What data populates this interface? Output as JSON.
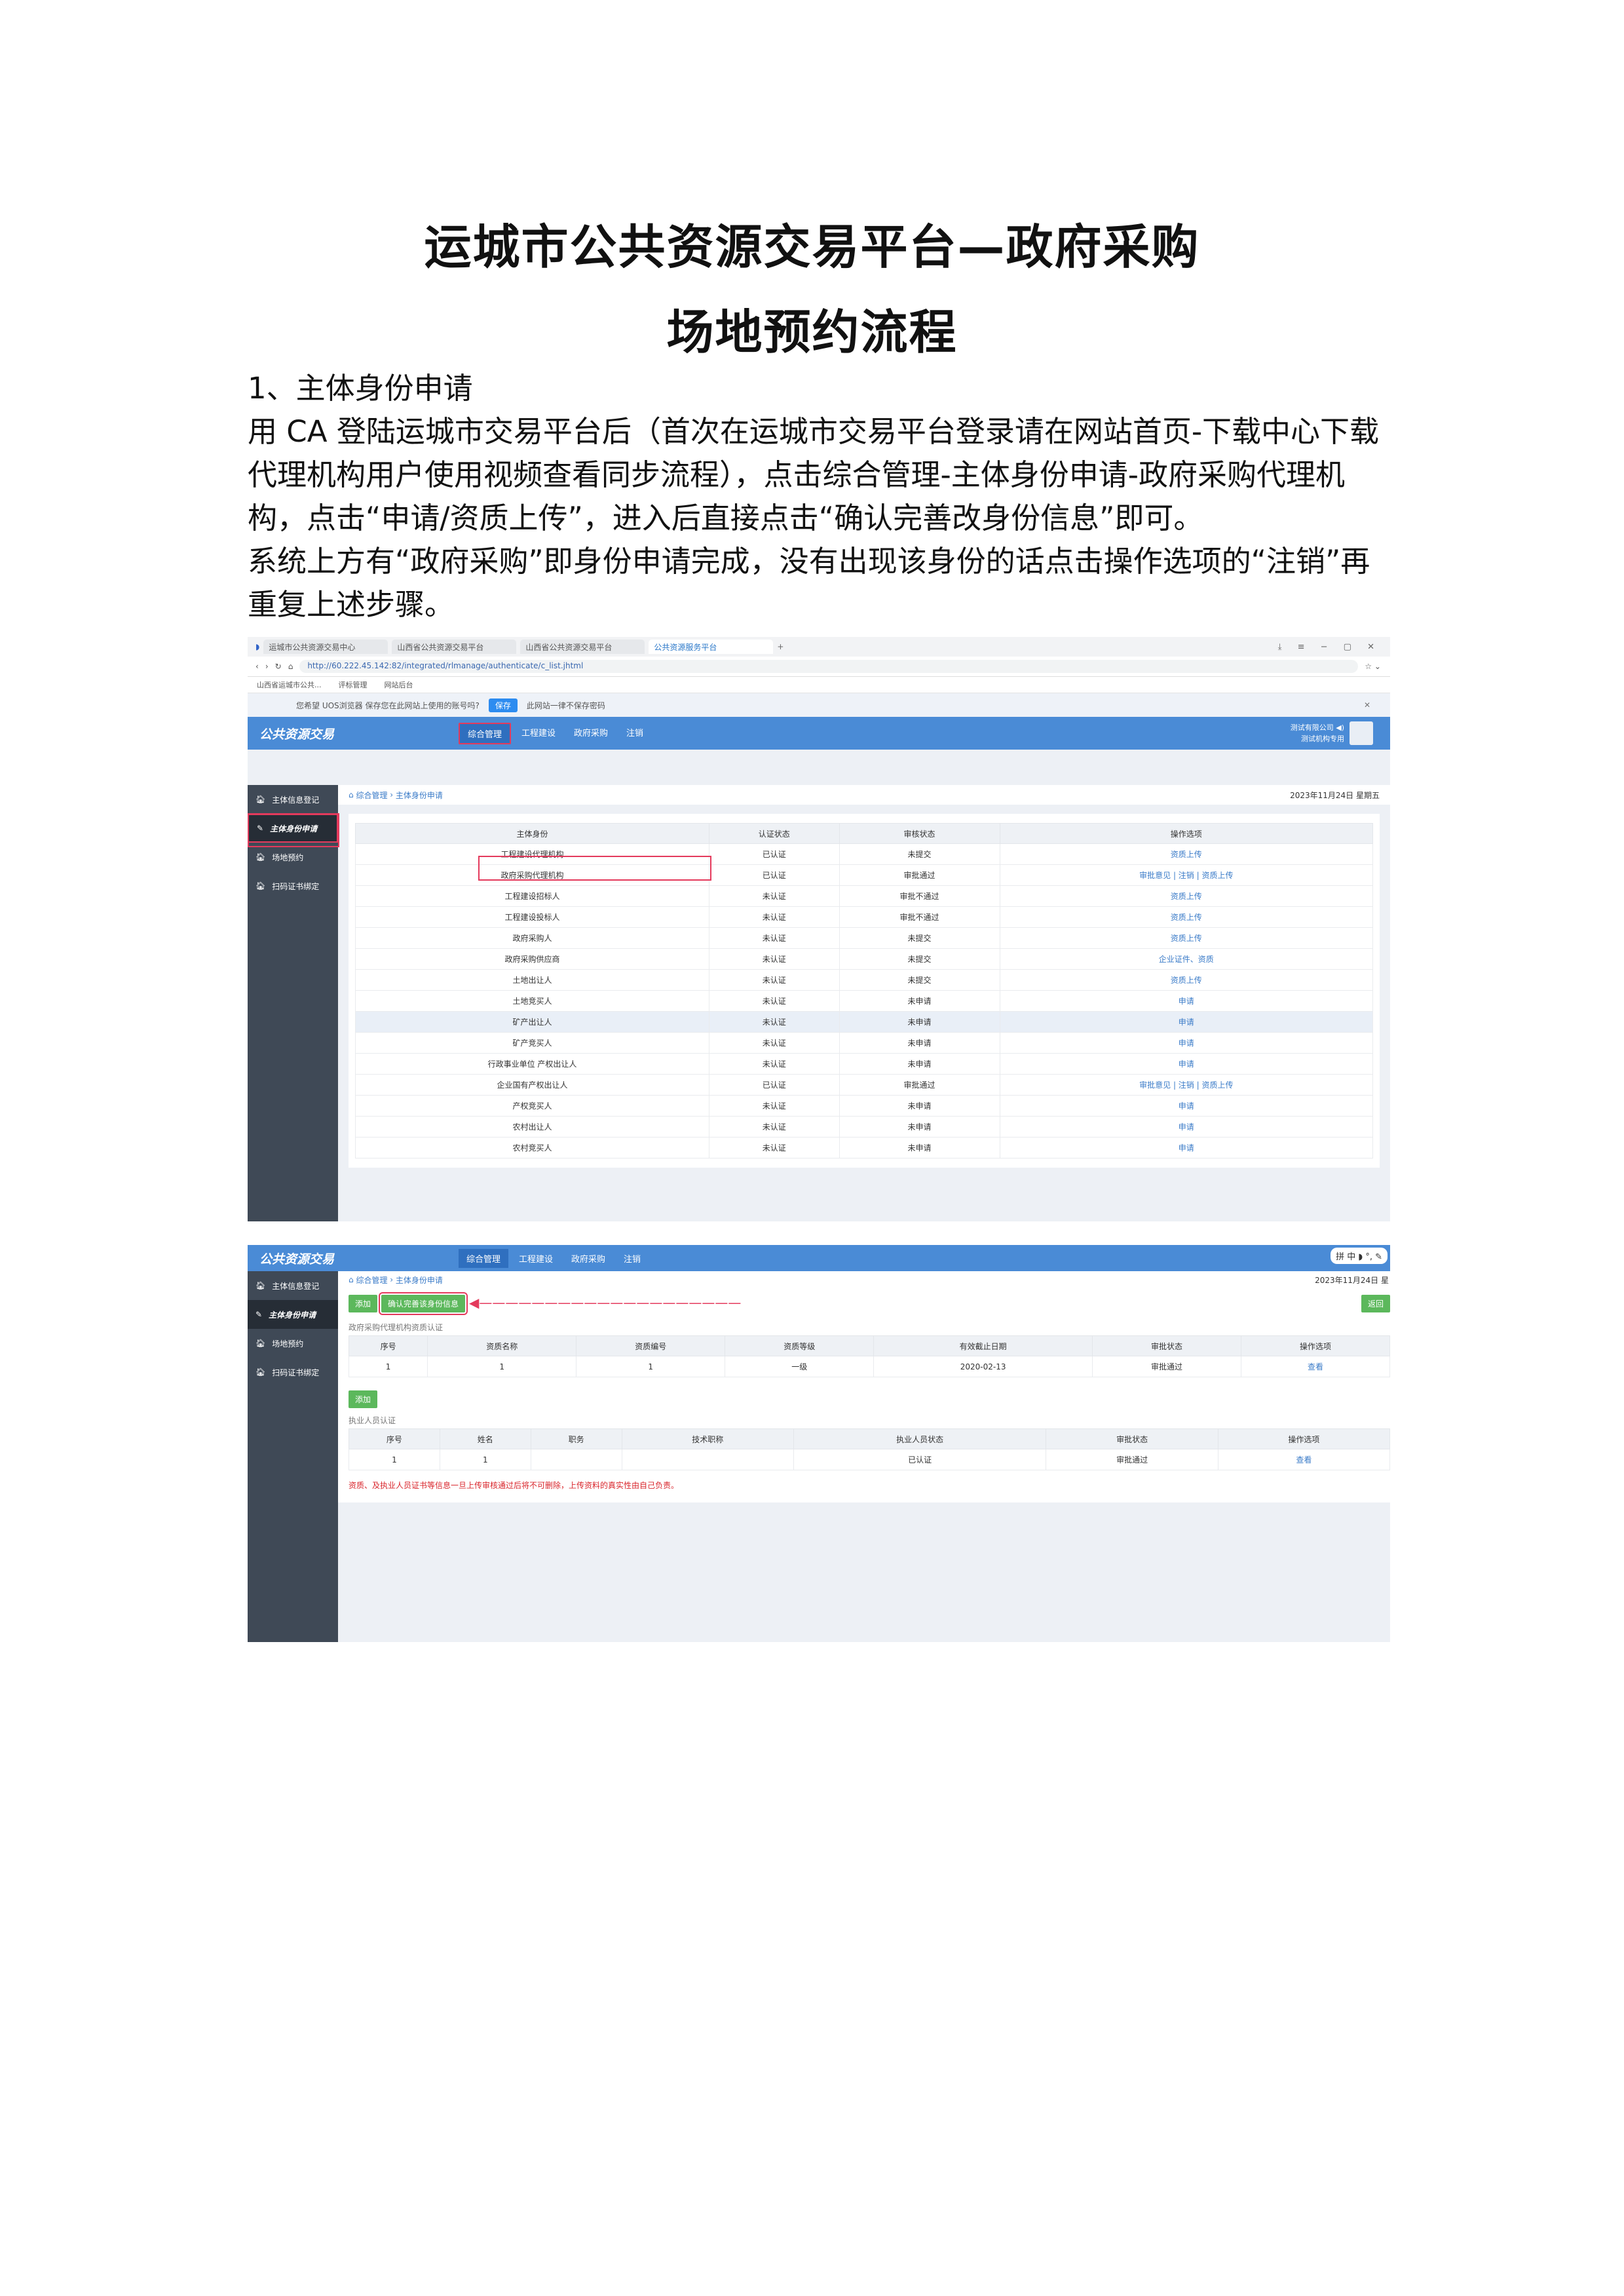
{
  "doc": {
    "title_line1": "运城市公共资源交易平台—政府采购",
    "title_line2": "场地预约流程",
    "section_heading": "1、主体身份申请",
    "body": "用 CA 登陆运城市交易平台后（首次在运城市交易平台登录请在网站首页-下载中心下载代理机构用户使用视频查看同步流程），点击综合管理-主体身份申请-政府采购代理机构，点击“申请/资质上传”，进入后直接点击“确认完善改身份信息”即可。",
    "note": "系统上方有“政府采购”即身份申请完成，没有出现该身份的话点击操作选项的“注销”再重复上述步骤。"
  },
  "browser": {
    "tabs": [
      "运城市公共资源交易中心",
      "山西省公共资源交易平台",
      "山西省公共资源交易平台",
      "公共资源服务平台"
    ],
    "url": "http://60.222.45.142:82/integrated/rlmanage/authenticate/c_list.jhtml",
    "bookmarks": [
      "山西省运城市公共...",
      "评标管理",
      "网站后台"
    ],
    "notice_text": "您希望 UOS浏览器 保存您在此网站上使用的账号吗?",
    "notice_save": "保存",
    "notice_never": "此网站一律不保存密码"
  },
  "app": {
    "logo": "公共资源交易",
    "nav": [
      "综合管理",
      "工程建设",
      "政府采购",
      "注销"
    ],
    "user_line1": "测试有限公司 ◀)",
    "user_line2": "测试机构专用",
    "sidebar": [
      "主体信息登记",
      "主体身份申请",
      "场地预约",
      "扫码证书绑定"
    ],
    "crumb": [
      "综合管理",
      "主体身份申请"
    ],
    "date1": "2023年11月24日 星期五",
    "date2": "2023年11月24日 星"
  },
  "table1": {
    "headers": [
      "主体身份",
      "认证状态",
      "审核状态",
      "操作选项"
    ],
    "rows": [
      [
        "工程建设代理机构",
        "已认证",
        "未提交",
        "资质上传"
      ],
      [
        "政府采购代理机构",
        "已认证",
        "审批通过",
        "审批意见 | 注销 | 资质上传"
      ],
      [
        "工程建设招标人",
        "未认证",
        "审批不通过",
        "资质上传"
      ],
      [
        "工程建设投标人",
        "未认证",
        "审批不通过",
        "资质上传"
      ],
      [
        "政府采购人",
        "未认证",
        "未提交",
        "资质上传"
      ],
      [
        "政府采购供应商",
        "未认证",
        "未提交",
        "企业证件、资质"
      ],
      [
        "土地出让人",
        "未认证",
        "未提交",
        "资质上传"
      ],
      [
        "土地竞买人",
        "未认证",
        "未申请",
        "申请"
      ],
      [
        "矿产出让人",
        "未认证",
        "未申请",
        "申请"
      ],
      [
        "矿产竞买人",
        "未认证",
        "未申请",
        "申请"
      ],
      [
        "行政事业单位 产权出让人",
        "未认证",
        "未申请",
        "申请"
      ],
      [
        "企业国有产权出让人",
        "已认证",
        "审批通过",
        "审批意见 | 注销 | 资质上传"
      ],
      [
        "产权竞买人",
        "未认证",
        "未申请",
        "申请"
      ],
      [
        "农村出让人",
        "未认证",
        "未申请",
        "申请"
      ],
      [
        "农村竞买人",
        "未认证",
        "未申请",
        "申请"
      ]
    ]
  },
  "screen2": {
    "btn_add": "添加",
    "btn_confirm": "确认完善该身份信息",
    "btn_back": "返回",
    "section1": "政府采购代理机构资质认证",
    "qual_headers": [
      "序号",
      "资质名称",
      "资质编号",
      "资质等级",
      "有效截止日期",
      "审批状态",
      "操作选项"
    ],
    "qual_row": [
      "1",
      "1",
      "1",
      "一级",
      "2020-02-13",
      "审批通过",
      "查看"
    ],
    "btn_add2": "添加",
    "section2": "执业人员认证",
    "staff_headers": [
      "序号",
      "姓名",
      "职务",
      "技术职称",
      "执业人员状态",
      "审批状态",
      "操作选项"
    ],
    "staff_row": [
      "1",
      "1",
      "",
      "",
      "已认证",
      "审批通过",
      "查看"
    ],
    "warning": "资质、及执业人员证书等信息一旦上传审核通过后将不可删除，上传资料的真实性由自己负责。",
    "ime": "拼 中 ◗ °, ✎"
  }
}
